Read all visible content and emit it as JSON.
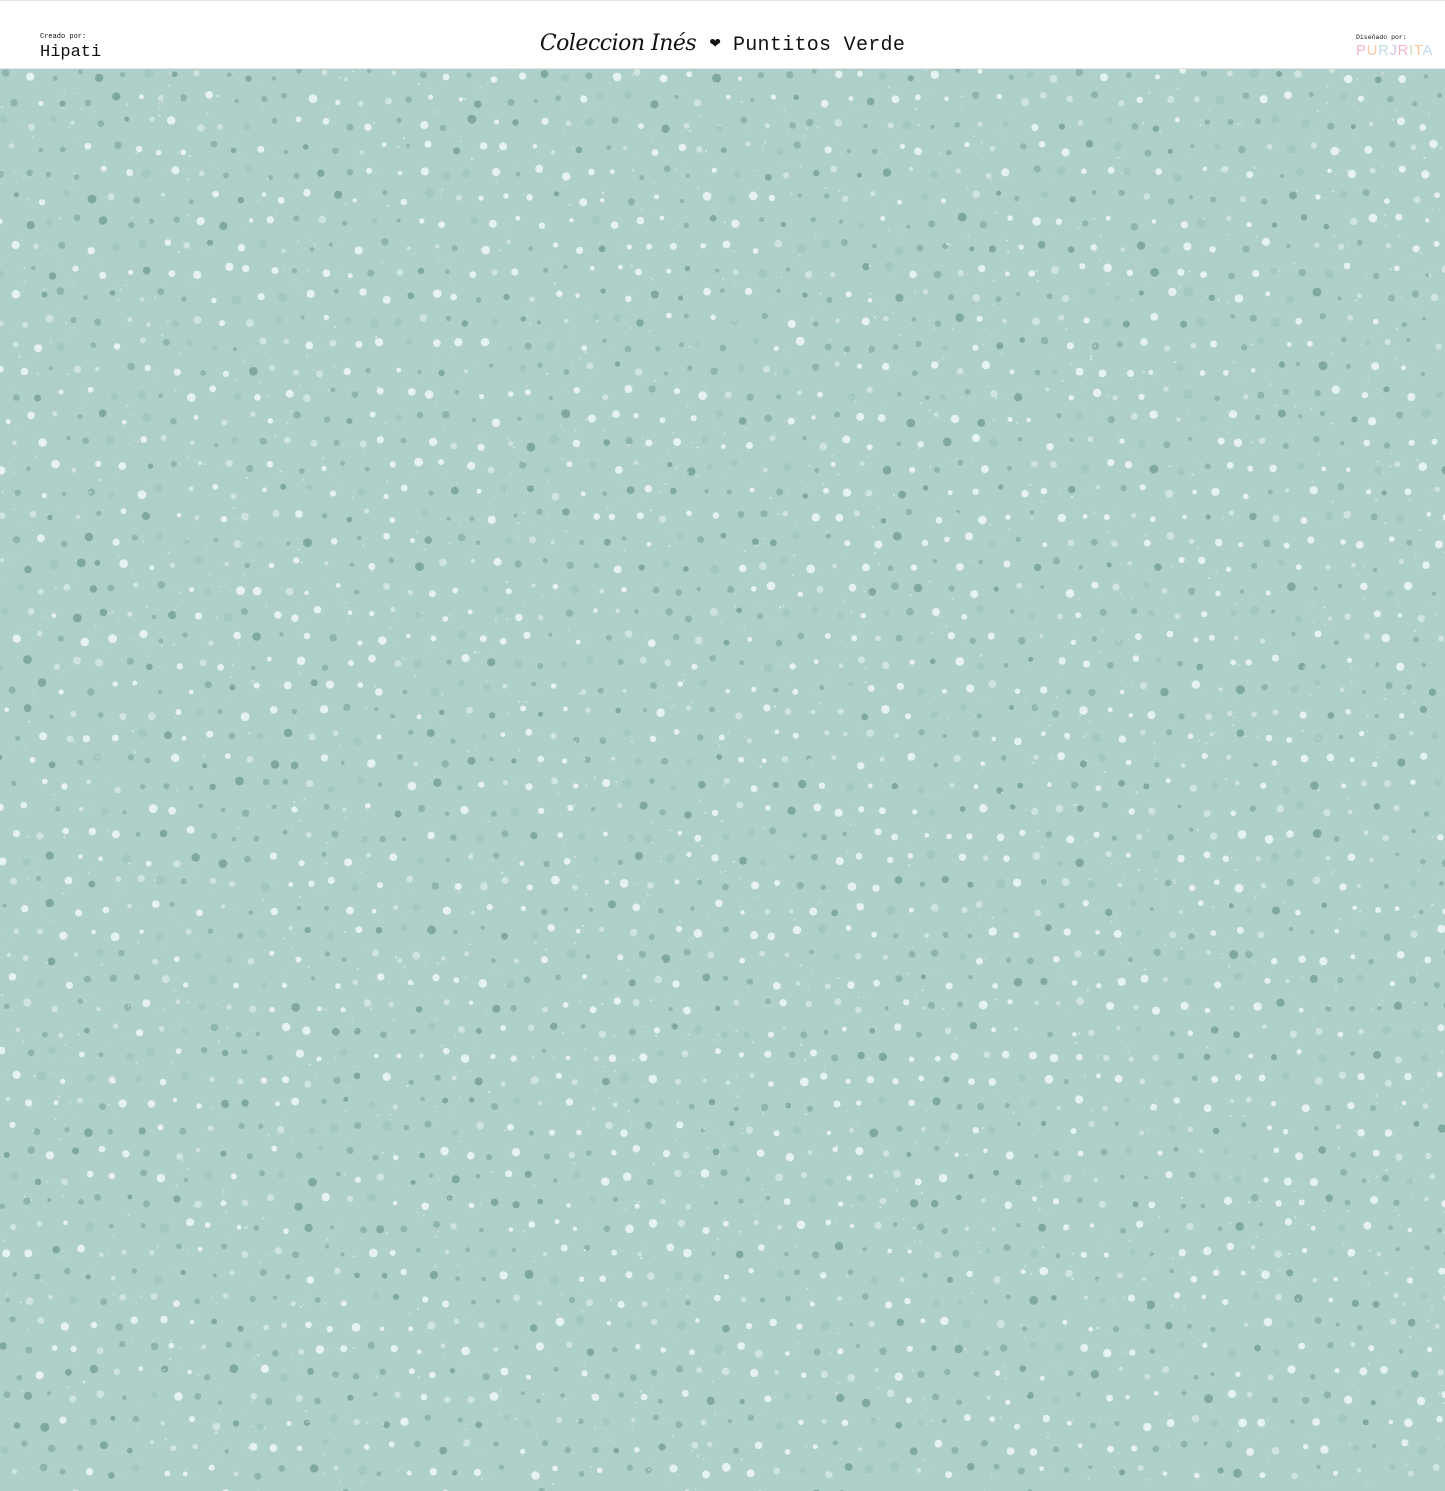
{
  "header": {
    "creator_label": "Creado por:",
    "creator_name": "Hipati",
    "collection_script": "Coleccion Inés",
    "separator_icon": "heart-icon",
    "pattern_name": "Puntitos Verde",
    "designer_label": "Diseñado por:",
    "designer_logo": "PURJRITA",
    "designer_logo_colors": [
      "#f3b5c6",
      "#f6c9a2",
      "#bfdbe7",
      "#d7c3e3",
      "#f3b5c6",
      "#c8e0c0",
      "#f6c9a2",
      "#bfdbe7"
    ]
  },
  "pattern": {
    "background_color": "#afcfcb",
    "dot_colors": [
      "#e6f2f0",
      "#cfe3e0",
      "#8eb5ad",
      "#7fa89f",
      "#a3c7c1"
    ],
    "style": "scattered polka dots with speckle texture"
  }
}
